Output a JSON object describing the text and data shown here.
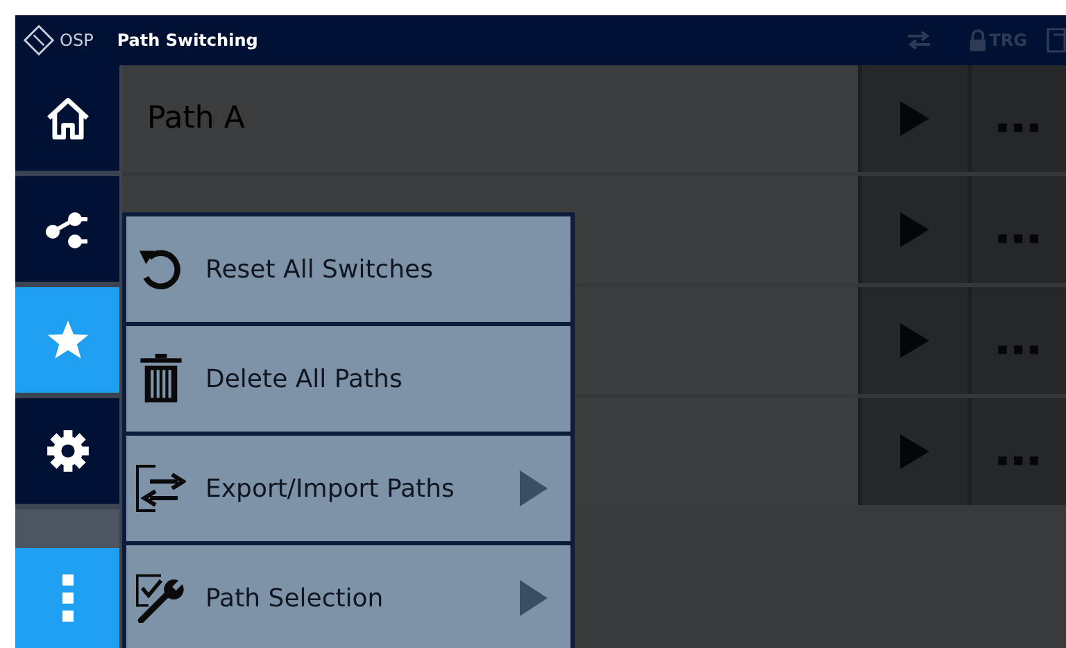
{
  "header": {
    "product": "OSP",
    "title": "Path Switching",
    "trigger_label": "TRG"
  },
  "sidebar": {
    "items": [
      {
        "kind": "home",
        "selected": false
      },
      {
        "kind": "paths",
        "selected": false
      },
      {
        "kind": "favorites",
        "selected": true
      },
      {
        "kind": "settings",
        "selected": false
      }
    ],
    "more_button": {
      "open": true
    }
  },
  "path_rows": [
    {
      "name": "Path A"
    },
    {},
    {},
    {}
  ],
  "context_menu": {
    "items": [
      {
        "kind": "reset",
        "label": "Reset All Switches",
        "submenu": false
      },
      {
        "kind": "delete",
        "label": "Delete All Paths",
        "submenu": false
      },
      {
        "kind": "export",
        "label": "Export/Import Paths",
        "submenu": true
      },
      {
        "kind": "select",
        "label": "Path Selection",
        "submenu": true
      }
    ]
  }
}
